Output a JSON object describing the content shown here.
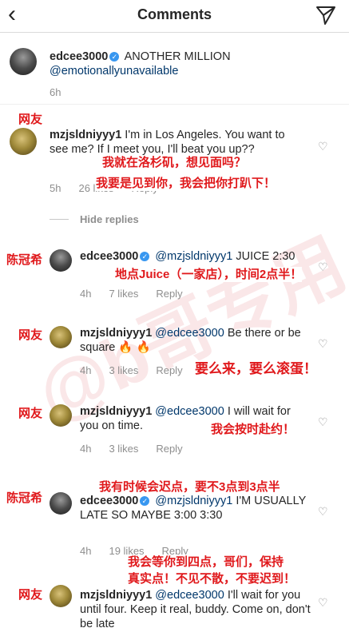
{
  "header": {
    "title": "Comments"
  },
  "caption": {
    "username": "edcee3000",
    "text": "ANOTHER MILLION",
    "mention": "@emotionallyunavailable",
    "time": "6h"
  },
  "comments": [
    {
      "username": "mzjsldniyyy1",
      "text": "I'm in Los Angeles. You want to see me? If I meet you, I'll beat you up??",
      "time": "5h",
      "likes": "26 likes",
      "reply": "Reply",
      "tag": "网友",
      "note1": "我就在洛杉矶，想见面吗？",
      "note2": "我要是见到你，我会把你打趴下！"
    },
    {
      "username": "edcee3000",
      "mention": "@mzjsldniyyy1",
      "text": "JUICE 2:30",
      "time": "4h",
      "likes": "7 likes",
      "reply": "Reply",
      "tag": "陈冠希",
      "note1": "地点Juice（一家店），时间2点半！"
    },
    {
      "username": "mzjsldniyyy1",
      "mention": "@edcee3000",
      "text": "Be there or be square",
      "emoji": "🔥 🔥",
      "time": "4h",
      "likes": "3 likes",
      "reply": "Reply",
      "tag": "网友",
      "note1": "要么来，要么滚蛋！"
    },
    {
      "username": "mzjsldniyyy1",
      "mention": "@edcee3000",
      "text": "I will wait for you on time.",
      "time": "4h",
      "likes": "3 likes",
      "reply": "Reply",
      "tag": "网友",
      "note1": "我会按时赴约！"
    },
    {
      "username": "edcee3000",
      "mention": "@mzjsldniyyy1",
      "text": "I'M USUALLY LATE SO MAYBE 3:00 3:30",
      "time": "4h",
      "likes": "19 likes",
      "reply": "Reply",
      "tag": "陈冠希",
      "note1": "我有时候会迟点，要不3点到3点半"
    },
    {
      "username": "mzjsldniyyy1",
      "mention": "@edcee3000",
      "text": "I'll wait for you until four. Keep it real, buddy. Come on, don't be late",
      "tag": "网友",
      "note1": "我会等你到四点，哥们，保持",
      "note2": "真实点！不见不散，不要迟到！"
    }
  ],
  "hide_replies": "Hide replies",
  "watermark": "@b哥专用"
}
